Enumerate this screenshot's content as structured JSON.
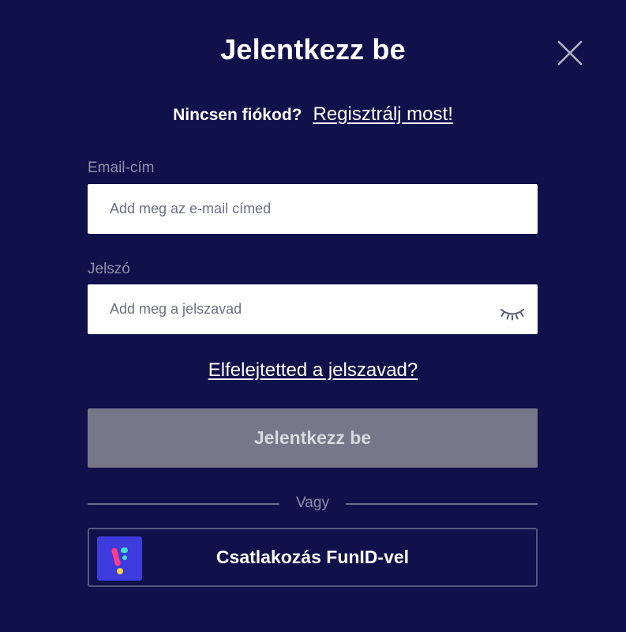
{
  "dialog": {
    "title": "Jelentkezz be"
  },
  "register": {
    "question": "Nincsen fiókod?",
    "link": "Regisztrálj most!"
  },
  "email": {
    "label": "Email-cím",
    "placeholder": "Add meg az e-mail címed",
    "value": ""
  },
  "password": {
    "label": "Jelszó",
    "placeholder": "Add meg a jelszavad",
    "value": ""
  },
  "forgot_link": "Elfelejtetted a jelszavad?",
  "login_button": "Jelentkezz be",
  "divider": "Vagy",
  "funid_button": "Csatlakozás FunID-vel",
  "colors": {
    "background": "#10114a",
    "login_button_disabled": "#787789",
    "funid_logo": "#3d3bdb"
  },
  "icons": {
    "close": "close-icon",
    "password_toggle": "eye-closed-icon",
    "funid": "funid-logo-icon"
  }
}
